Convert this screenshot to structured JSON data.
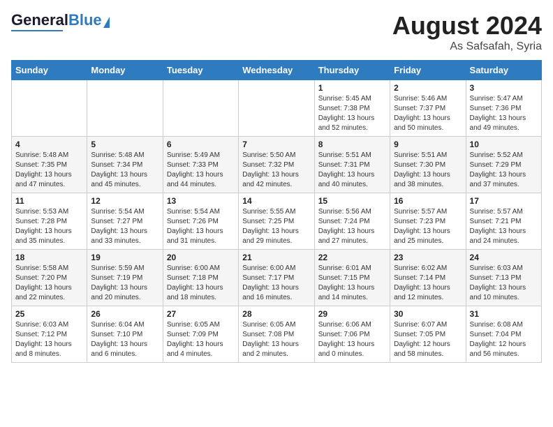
{
  "header": {
    "logo_general": "General",
    "logo_blue": "Blue",
    "month": "August 2024",
    "location": "As Safsafah, Syria"
  },
  "days_of_week": [
    "Sunday",
    "Monday",
    "Tuesday",
    "Wednesday",
    "Thursday",
    "Friday",
    "Saturday"
  ],
  "weeks": [
    [
      {
        "day": "",
        "sunrise": "",
        "sunset": "",
        "daylight": ""
      },
      {
        "day": "",
        "sunrise": "",
        "sunset": "",
        "daylight": ""
      },
      {
        "day": "",
        "sunrise": "",
        "sunset": "",
        "daylight": ""
      },
      {
        "day": "",
        "sunrise": "",
        "sunset": "",
        "daylight": ""
      },
      {
        "day": "1",
        "sunrise": "5:45 AM",
        "sunset": "7:38 PM",
        "daylight": "13 hours and 52 minutes."
      },
      {
        "day": "2",
        "sunrise": "5:46 AM",
        "sunset": "7:37 PM",
        "daylight": "13 hours and 50 minutes."
      },
      {
        "day": "3",
        "sunrise": "5:47 AM",
        "sunset": "7:36 PM",
        "daylight": "13 hours and 49 minutes."
      }
    ],
    [
      {
        "day": "4",
        "sunrise": "5:48 AM",
        "sunset": "7:35 PM",
        "daylight": "13 hours and 47 minutes."
      },
      {
        "day": "5",
        "sunrise": "5:48 AM",
        "sunset": "7:34 PM",
        "daylight": "13 hours and 45 minutes."
      },
      {
        "day": "6",
        "sunrise": "5:49 AM",
        "sunset": "7:33 PM",
        "daylight": "13 hours and 44 minutes."
      },
      {
        "day": "7",
        "sunrise": "5:50 AM",
        "sunset": "7:32 PM",
        "daylight": "13 hours and 42 minutes."
      },
      {
        "day": "8",
        "sunrise": "5:51 AM",
        "sunset": "7:31 PM",
        "daylight": "13 hours and 40 minutes."
      },
      {
        "day": "9",
        "sunrise": "5:51 AM",
        "sunset": "7:30 PM",
        "daylight": "13 hours and 38 minutes."
      },
      {
        "day": "10",
        "sunrise": "5:52 AM",
        "sunset": "7:29 PM",
        "daylight": "13 hours and 37 minutes."
      }
    ],
    [
      {
        "day": "11",
        "sunrise": "5:53 AM",
        "sunset": "7:28 PM",
        "daylight": "13 hours and 35 minutes."
      },
      {
        "day": "12",
        "sunrise": "5:54 AM",
        "sunset": "7:27 PM",
        "daylight": "13 hours and 33 minutes."
      },
      {
        "day": "13",
        "sunrise": "5:54 AM",
        "sunset": "7:26 PM",
        "daylight": "13 hours and 31 minutes."
      },
      {
        "day": "14",
        "sunrise": "5:55 AM",
        "sunset": "7:25 PM",
        "daylight": "13 hours and 29 minutes."
      },
      {
        "day": "15",
        "sunrise": "5:56 AM",
        "sunset": "7:24 PM",
        "daylight": "13 hours and 27 minutes."
      },
      {
        "day": "16",
        "sunrise": "5:57 AM",
        "sunset": "7:23 PM",
        "daylight": "13 hours and 25 minutes."
      },
      {
        "day": "17",
        "sunrise": "5:57 AM",
        "sunset": "7:21 PM",
        "daylight": "13 hours and 24 minutes."
      }
    ],
    [
      {
        "day": "18",
        "sunrise": "5:58 AM",
        "sunset": "7:20 PM",
        "daylight": "13 hours and 22 minutes."
      },
      {
        "day": "19",
        "sunrise": "5:59 AM",
        "sunset": "7:19 PM",
        "daylight": "13 hours and 20 minutes."
      },
      {
        "day": "20",
        "sunrise": "6:00 AM",
        "sunset": "7:18 PM",
        "daylight": "13 hours and 18 minutes."
      },
      {
        "day": "21",
        "sunrise": "6:00 AM",
        "sunset": "7:17 PM",
        "daylight": "13 hours and 16 minutes."
      },
      {
        "day": "22",
        "sunrise": "6:01 AM",
        "sunset": "7:15 PM",
        "daylight": "13 hours and 14 minutes."
      },
      {
        "day": "23",
        "sunrise": "6:02 AM",
        "sunset": "7:14 PM",
        "daylight": "13 hours and 12 minutes."
      },
      {
        "day": "24",
        "sunrise": "6:03 AM",
        "sunset": "7:13 PM",
        "daylight": "13 hours and 10 minutes."
      }
    ],
    [
      {
        "day": "25",
        "sunrise": "6:03 AM",
        "sunset": "7:12 PM",
        "daylight": "13 hours and 8 minutes."
      },
      {
        "day": "26",
        "sunrise": "6:04 AM",
        "sunset": "7:10 PM",
        "daylight": "13 hours and 6 minutes."
      },
      {
        "day": "27",
        "sunrise": "6:05 AM",
        "sunset": "7:09 PM",
        "daylight": "13 hours and 4 minutes."
      },
      {
        "day": "28",
        "sunrise": "6:05 AM",
        "sunset": "7:08 PM",
        "daylight": "13 hours and 2 minutes."
      },
      {
        "day": "29",
        "sunrise": "6:06 AM",
        "sunset": "7:06 PM",
        "daylight": "13 hours and 0 minutes."
      },
      {
        "day": "30",
        "sunrise": "6:07 AM",
        "sunset": "7:05 PM",
        "daylight": "12 hours and 58 minutes."
      },
      {
        "day": "31",
        "sunrise": "6:08 AM",
        "sunset": "7:04 PM",
        "daylight": "12 hours and 56 minutes."
      }
    ]
  ]
}
